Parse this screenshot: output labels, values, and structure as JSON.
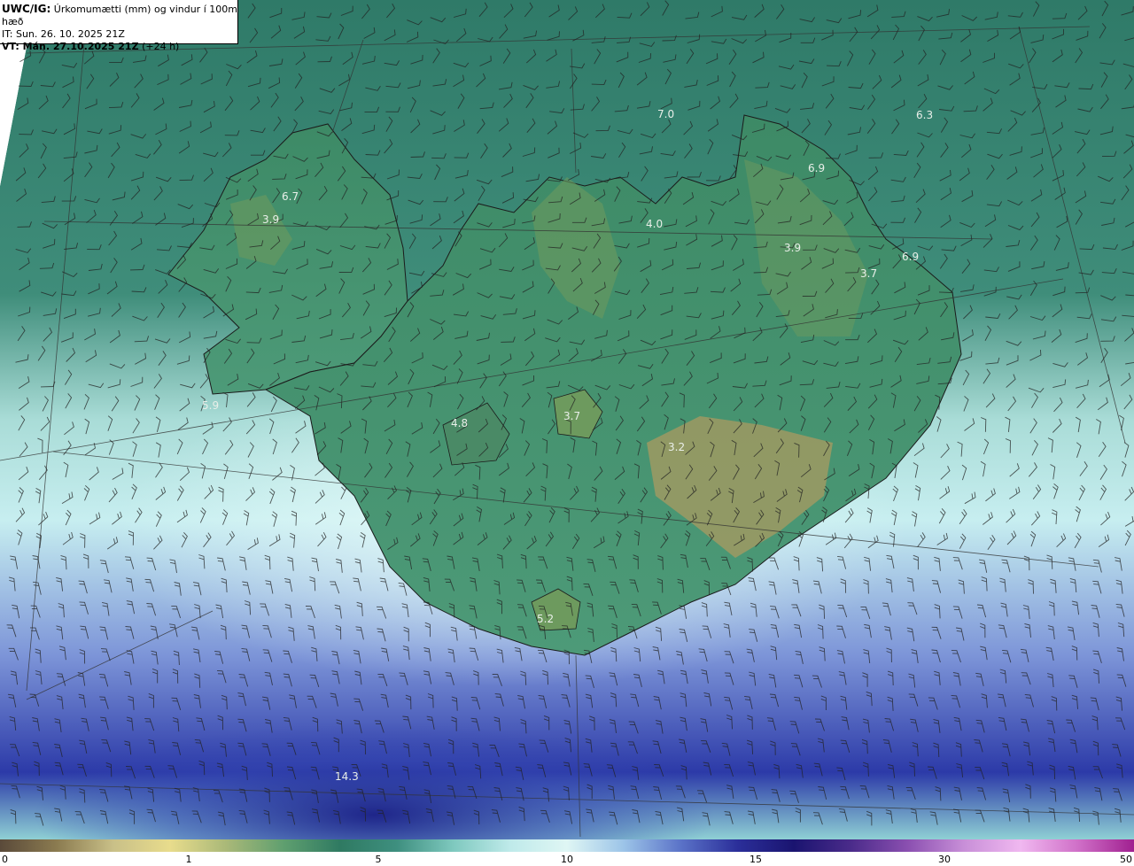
{
  "header": {
    "product": "UWC/IG:",
    "title": "Úrkomumætti (mm) og vindur í 100m hæð",
    "init_time": "IT: Sun. 26. 10. 2025 21Z",
    "valid_prefix": "VT: Mán. 27.10.2025 21Z",
    "valid_suffix": "(+24 h)"
  },
  "map": {
    "region": "Iceland",
    "value_labels": [
      "7.0",
      "6.3",
      "6.9",
      "6.7",
      "3.9",
      "4.0",
      "3.9",
      "3.7",
      "6.9",
      "5.9",
      "4.8",
      "3.7",
      "3.2",
      "5.2",
      "14.3"
    ]
  },
  "colorbar": {
    "ticks": [
      "0",
      "1",
      "5",
      "10",
      "15",
      "30",
      "50"
    ],
    "colors": [
      "#5a4a3a",
      "#8b7b50",
      "#c9c088",
      "#e8dc8c",
      "#a9b878",
      "#5f9f6f",
      "#2f7a62",
      "#3e8f7f",
      "#7fc9bf",
      "#bfeaea",
      "#dff6f4",
      "#9cc4e8",
      "#5b73c8",
      "#2b2f9a",
      "#1a1470",
      "#4a2b8a",
      "#8a4fb0",
      "#c88fd8",
      "#f0b8f0",
      "#d070c8",
      "#a02090"
    ]
  }
}
